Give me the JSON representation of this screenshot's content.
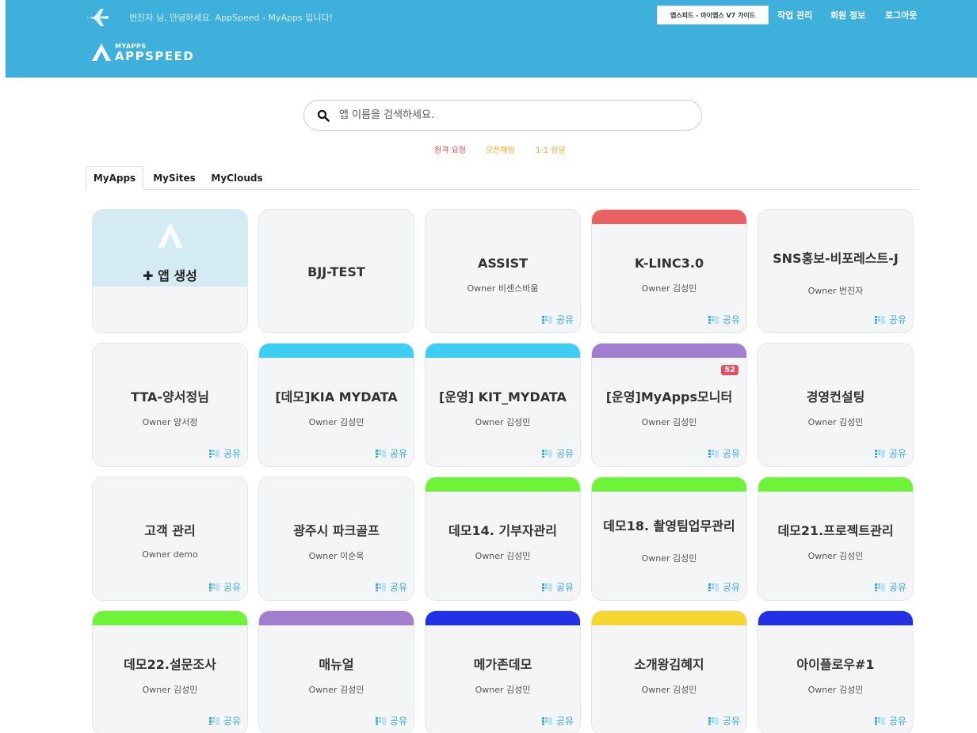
{
  "header": {
    "welcome": "번진자 님, 안녕하세요. AppSpeed - MyApps 입니다!",
    "guide_button": "앱스피드 - 마이앱스 V7 가이드",
    "links": [
      "작업 관리",
      "회원 정보",
      "로그아웃"
    ],
    "logo_small": "MYAPPS",
    "logo_big": "APPSPEED"
  },
  "search": {
    "placeholder": "앱 이름을 검색하세요."
  },
  "support": [
    {
      "label": "원격 요청",
      "color": "#e8484f"
    },
    {
      "label": "오픈채팅",
      "color": "#f4a428"
    },
    {
      "label": "1:1 상담",
      "color": "#f4a428"
    }
  ],
  "tabs": [
    "MyApps",
    "MySites",
    "MyClouds"
  ],
  "create_label": "앱 생성",
  "share_label": "공유",
  "owner_prefix": "Owner",
  "apps": [
    {
      "title": "BJJ-TEST",
      "owner": "",
      "bar": ""
    },
    {
      "title": "ASSIST",
      "owner": "Owner 비센스바움",
      "bar": ""
    },
    {
      "title": "K-LINC3.0",
      "owner": "Owner 김성민",
      "bar": "#e86163"
    },
    {
      "title": "SNS홍보-비포레스트-J",
      "owner": "Owner 번진자",
      "bar": ""
    },
    {
      "title": "TTA-양서정님",
      "owner": "Owner 양서정",
      "bar": ""
    },
    {
      "title": "[데모]KIA MYDATA",
      "owner": "Owner 김성민",
      "bar": "#3ecdf3"
    },
    {
      "title": "[운영] KIT_MYDATA",
      "owner": "Owner 김성민",
      "bar": "#3ecdf3"
    },
    {
      "title": "[운영]MyApps모니터",
      "owner": "Owner 김성민",
      "bar": "#a07fcf",
      "badge": "52"
    },
    {
      "title": "경영컨설팅",
      "owner": "Owner 김성민",
      "bar": ""
    },
    {
      "title": "고객 관리",
      "owner": "Owner demo",
      "bar": ""
    },
    {
      "title": "광주시 파크골프",
      "owner": "Owner 이순옥",
      "bar": ""
    },
    {
      "title": "데모14. 기부자관리",
      "owner": "Owner 김성민",
      "bar": "#6df437"
    },
    {
      "title": "데모18. 촬영팀업무관리",
      "owner": "Owner 김성민",
      "bar": "#6df437"
    },
    {
      "title": "데모21.프로젝트관리",
      "owner": "Owner 김성민",
      "bar": "#6df437"
    },
    {
      "title": "데모22.설문조사",
      "owner": "Owner 김성민",
      "bar": "#6df437"
    },
    {
      "title": "매뉴얼",
      "owner": "Owner 김성민",
      "bar": "#a07fcf"
    },
    {
      "title": "메가존데모",
      "owner": "Owner 김성민",
      "bar": "#2331e6"
    },
    {
      "title": "소개왕김혜지",
      "owner": "Owner 김성민",
      "bar": "#f6d631"
    },
    {
      "title": "아이플로우#1",
      "owner": "Owner 김성민",
      "bar": "#2331e6"
    }
  ]
}
